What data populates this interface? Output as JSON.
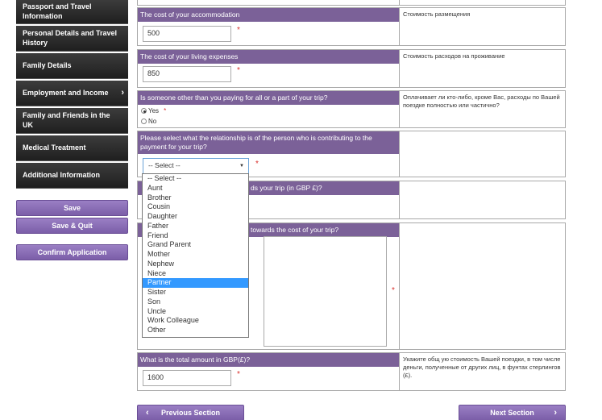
{
  "sidebar": {
    "items": [
      {
        "label": "Passport and Travel Information"
      },
      {
        "label": "Personal Details and Travel History"
      },
      {
        "label": "Family Details"
      },
      {
        "label": "Employment and Income"
      },
      {
        "label": "Family and Friends in the UK"
      },
      {
        "label": "Medical Treatment"
      },
      {
        "label": "Additional Information"
      }
    ],
    "save": "Save",
    "save_quit": "Save & Quit",
    "confirm": "Confirm Application"
  },
  "form": {
    "accommodation": {
      "question": "The cost of your accommodation",
      "translation": "Стоимость размещения",
      "value": "500"
    },
    "living": {
      "question": "The cost of your living expenses",
      "translation": "Стоимость расходов на проживание",
      "value": "850"
    },
    "someone_paying": {
      "question": "Is someone other than you paying for all or a part of your trip?",
      "translation": "Оплачивает ли кто-либо, кроме Вас, расходы по Вашей поездке полностью или частично?",
      "yes": "Yes",
      "no": "No"
    },
    "relationship": {
      "question": "Please select what the relationship is of the person who is contributing to the payment for your trip?",
      "selected": "-- Select --",
      "options": [
        "-- Select --",
        "Aunt",
        "Brother",
        "Cousin",
        "Daughter",
        "Father",
        "Friend",
        "Grand Parent",
        "Mother",
        "Nephew",
        "Niece",
        "Partner",
        "Sister",
        "Son",
        "Uncle",
        "Work Colleague",
        "Other"
      ],
      "highlighted": "Partner"
    },
    "amount_gbp_partial": "ds your trip (in GBP £)?",
    "contribution_partial": "towards the cost of your trip?",
    "total": {
      "question": "What is the total amount in GBP(£)?",
      "translation": "Укажите общ ую стоимость Вашей поездки, в том числе деньги, полученные от других лиц, в фунтах стерлингов (£).",
      "value": "1600"
    }
  },
  "nav": {
    "previous": "Previous Section",
    "next": "Next Section"
  }
}
